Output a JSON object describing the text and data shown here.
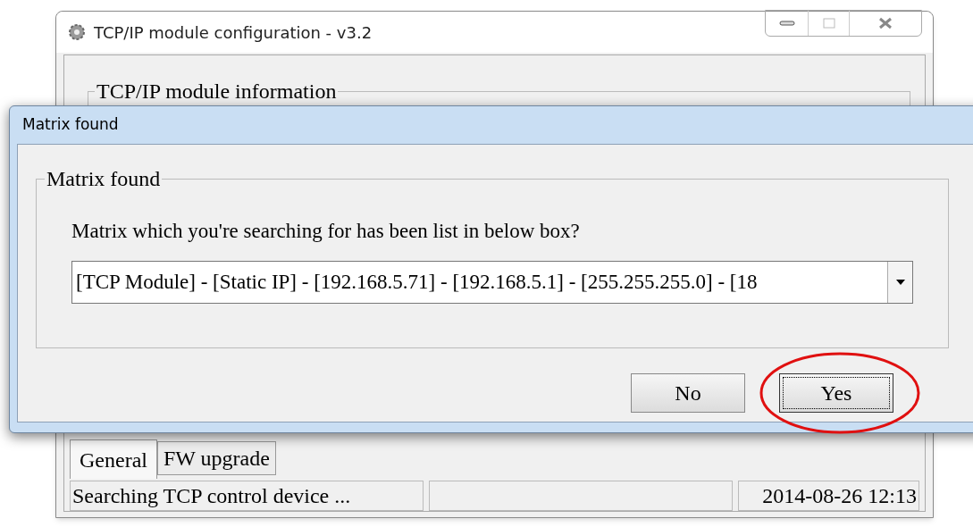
{
  "main_window": {
    "title": "TCP/IP module configuration - v3.2",
    "group_title": "TCP/IP module information",
    "tabs": [
      {
        "label": "General",
        "selected": true
      },
      {
        "label": "FW upgrade",
        "selected": false
      }
    ],
    "status_bar": {
      "message": "Searching TCP control device ...",
      "timestamp": "2014-08-26 12:13"
    }
  },
  "dialog": {
    "title": "Matrix found",
    "group_title": "Matrix found",
    "message": "Matrix which you're searching for has been list in below box?",
    "combo_value": "[TCP Module] - [Static IP] - [192.168.5.71] - [192.168.5.1] - [255.255.255.0] - [18",
    "buttons": [
      {
        "label": "No",
        "focused": false,
        "highlighted": false
      },
      {
        "label": "Yes",
        "focused": true,
        "highlighted": true
      }
    ]
  }
}
